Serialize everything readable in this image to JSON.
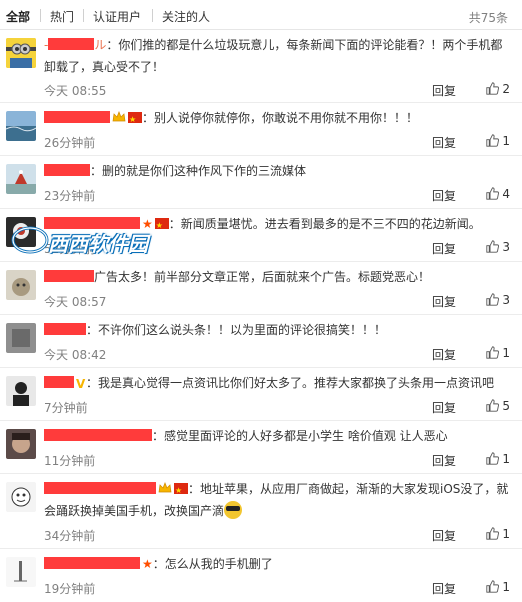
{
  "tabs": [
    {
      "label": "全部",
      "active": true
    },
    {
      "label": "热门",
      "active": false
    },
    {
      "label": "认证用户",
      "active": false
    },
    {
      "label": "关注的人",
      "active": false
    }
  ],
  "total": "共75条",
  "reply_label": "回复",
  "comments": [
    {
      "name_suffix": "ル",
      "text": "：你们推的都是什么垃圾玩意儿，每条新闻下面的评论能看？！两个手机都卸载了，真心受不了！",
      "time": "今天 08:55",
      "likes": "2",
      "avatar": "minion"
    },
    {
      "name_suffix": "",
      "text": "：别人说停你就停你，你敢说不用你就不用你！！！",
      "time": "26分钟前",
      "likes": "1",
      "avatar": "sea"
    },
    {
      "name_suffix": "",
      "text": "：删的就是你们这种作风下作的三流媒体",
      "time": "23分钟前",
      "likes": "4",
      "avatar": "santa"
    },
    {
      "name_suffix": "",
      "text": "：新闻质量堪忧。进去看到最多的是不三不四的花边新闻。",
      "time": "52分钟前",
      "likes": "3",
      "avatar": "dark"
    },
    {
      "name_suffix": "",
      "text": "广告太多！前半部分文章正常，后面就来个广告。标题党恶心！",
      "time": "今天 08:57",
      "likes": "3",
      "avatar": "cat"
    },
    {
      "name_suffix": "",
      "text": "：不许你们这么说头条！！以为里面的评论很搞笑！！！",
      "time": "今天 08:42",
      "likes": "1",
      "avatar": "grey"
    },
    {
      "name_suffix": "",
      "text": "：我是真心觉得一点资讯比你们好太多了。推荐大家都换了头条用一点资讯吧",
      "time": "7分钟前",
      "likes": "5",
      "avatar": "bw"
    },
    {
      "name_suffix": "",
      "text": "：感觉里面评论的人好多都是小学生 啥价值观 让人恶心",
      "time": "11分钟前",
      "likes": "1",
      "avatar": "face"
    },
    {
      "name_suffix": "",
      "text": "：地址苹果，从应用厂商做起，渐渐的大家发现iOS没了，就会踊跃换掉美国手机，改换国产滴",
      "time": "34分钟前",
      "likes": "1",
      "avatar": "cartoon"
    },
    {
      "name_suffix": "",
      "text": "：怎么从我的手机删了",
      "time": "19分钟前",
      "likes": "1",
      "avatar": "white"
    }
  ],
  "watermark": "西西软件园",
  "colors": {
    "name": "#eb7350",
    "redact": "#ff3b3b",
    "time": "#808080"
  }
}
